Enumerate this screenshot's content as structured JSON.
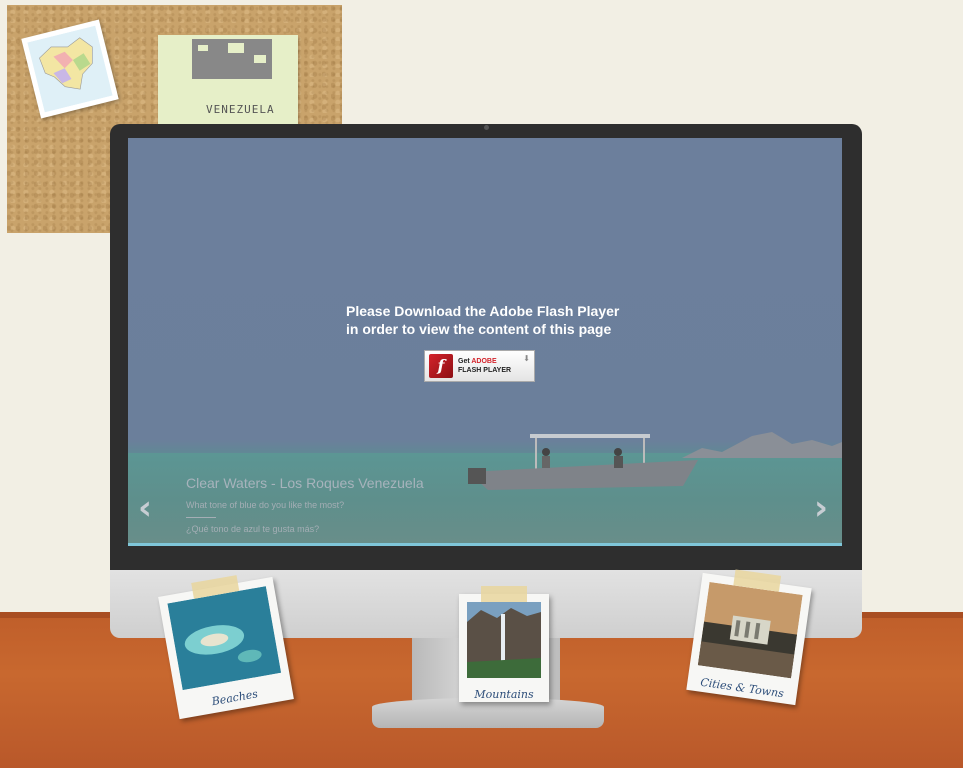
{
  "corkboard": {
    "note_label": "VENEZUELA"
  },
  "screen": {
    "flash_message_line1": "Please Download the Adobe Flash Player",
    "flash_message_line2": "in order to view the content of this page",
    "flash_button": {
      "get": "Get",
      "adobe": "ADOBE",
      "product": "FLASH",
      "player": "PLAYER"
    },
    "slide": {
      "title": "Clear Waters - Los Roques Venezuela",
      "subtitle_en": "What tone of blue do you like the most?",
      "subtitle_es": "¿Qué tono de azul te gusta más?"
    },
    "prev_arrow": "‹",
    "next_arrow": "›"
  },
  "polaroids": [
    {
      "caption": "Beaches"
    },
    {
      "caption": "Mountains"
    },
    {
      "caption": "Cities & Towns"
    }
  ],
  "colors": {
    "background": "#f2efe4",
    "desk": "#c8682f",
    "screen_overlay": "#6c7f9c",
    "accent_bar": "#7fc6d9"
  }
}
